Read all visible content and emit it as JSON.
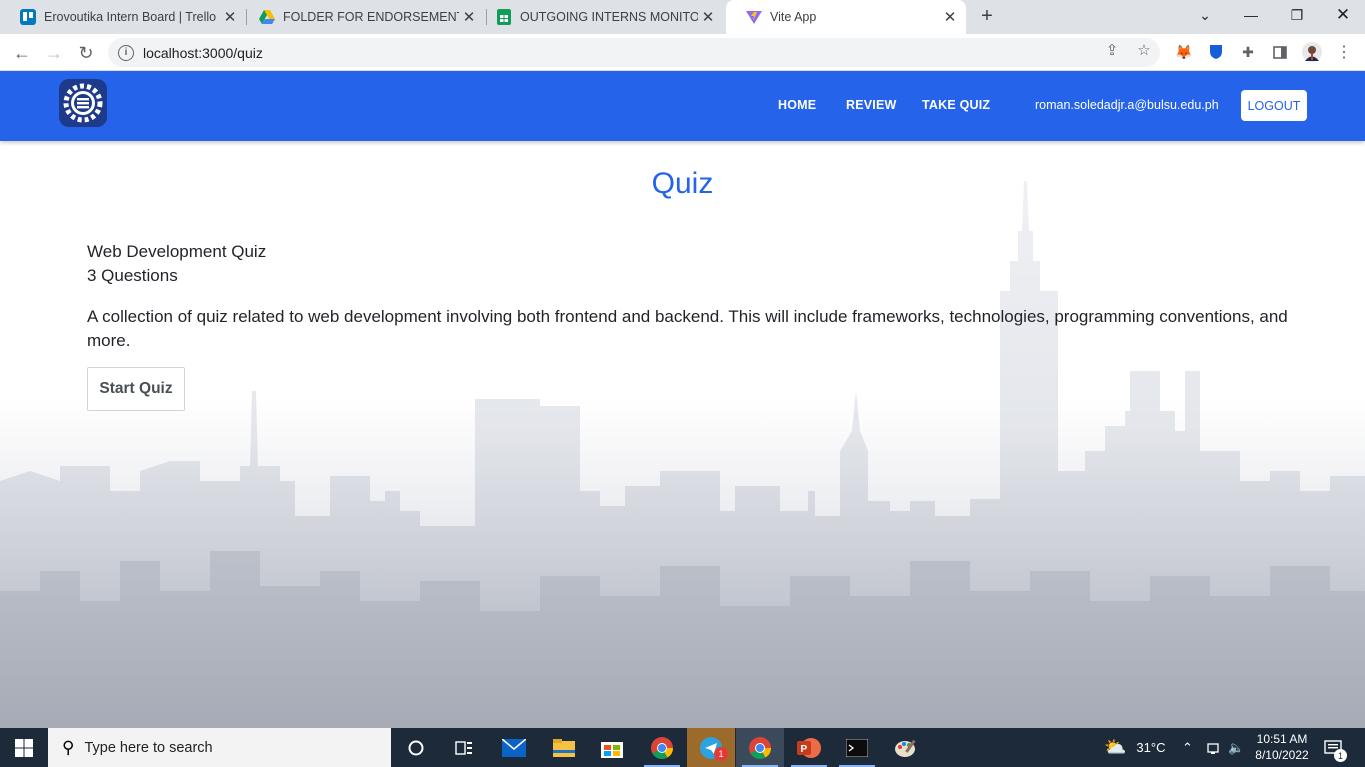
{
  "browser": {
    "tabs": [
      {
        "title": "Erovoutika Intern Board | Trello",
        "icon": "trello-icon",
        "color": "#0079bf"
      },
      {
        "title": "FOLDER FOR ENDORSEMENT BATCH",
        "icon": "google-drive-icon",
        "color": "#fbbc04"
      },
      {
        "title": "OUTGOING INTERNS MONITORING",
        "icon": "google-sheets-icon",
        "color": "#0f9d58"
      },
      {
        "title": "Vite App",
        "icon": "vite-icon",
        "color": "#8e6cf2"
      }
    ],
    "active_tab": 3,
    "url": "localhost:3000/quiz"
  },
  "app": {
    "nav": {
      "home": "HOME",
      "review": "REVIEW",
      "take_quiz": "TAKE QUIZ",
      "email": "roman.soledadjr.a@bulsu.edu.ph",
      "logout": "LOGOUT"
    },
    "heading": "Quiz",
    "quiz": {
      "title": "Web Development Quiz",
      "count": "3 Questions",
      "description": "A collection of quiz related to web development involving both frontend and backend. This will include frameworks, technologies, programming conventions, and more.",
      "start_label": "Start Quiz"
    },
    "colors": {
      "primary": "#2563eb"
    }
  },
  "taskbar": {
    "search_placeholder": "Type here to search",
    "weather": "31°C",
    "time": "10:51 AM",
    "date": "8/10/2022",
    "telegram_badge": "1",
    "notification_badge": "1"
  }
}
